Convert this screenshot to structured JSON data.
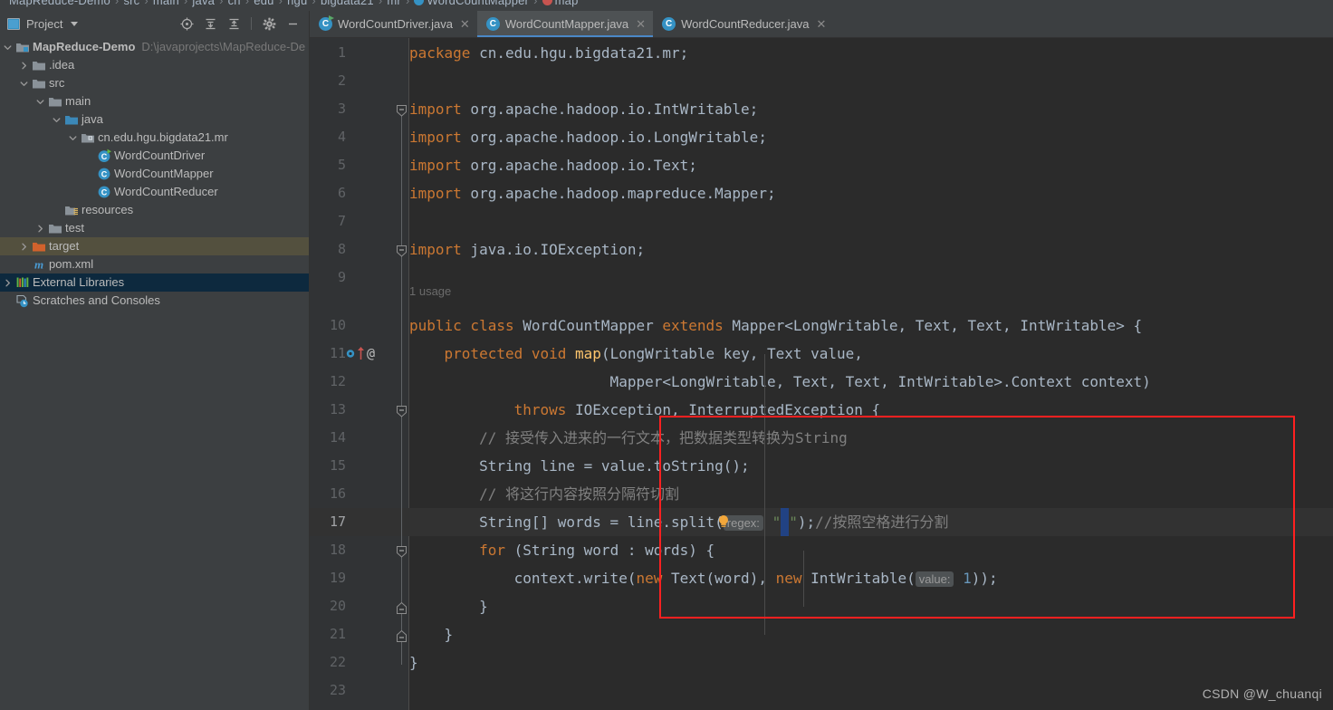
{
  "breadcrumb": {
    "items": [
      {
        "label": "MapReduce-Demo",
        "icon": "none"
      },
      {
        "label": "src",
        "icon": "none"
      },
      {
        "label": "main",
        "icon": "none"
      },
      {
        "label": "java",
        "icon": "none"
      },
      {
        "label": "cn",
        "icon": "none"
      },
      {
        "label": "edu",
        "icon": "none"
      },
      {
        "label": "hgu",
        "icon": "none"
      },
      {
        "label": "bigdata21",
        "icon": "none"
      },
      {
        "label": "mr",
        "icon": "none"
      },
      {
        "label": "WordCountMapper",
        "icon": "class-icon"
      },
      {
        "label": "map",
        "icon": "method-icon"
      }
    ],
    "separator": "›"
  },
  "project_panel": {
    "title": "Project",
    "dropdown_icon": "chevron-down-icon",
    "panel_icon": "project-view-icon",
    "toolbar": [
      {
        "name": "select-opened-file-icon",
        "tooltip": "Select Opened File"
      },
      {
        "name": "expand-all-icon",
        "tooltip": "Expand All"
      },
      {
        "name": "collapse-all-icon",
        "tooltip": "Collapse All"
      },
      {
        "name": "settings-gear-icon",
        "tooltip": "Settings"
      },
      {
        "name": "hide-icon",
        "tooltip": "Hide"
      }
    ],
    "tree": [
      {
        "label": "MapReduce-Demo",
        "suffix": "D:\\javaprojects\\MapReduce-De",
        "depth": 0,
        "arrow": "down",
        "icon": "project-module-icon",
        "bold": true,
        "selected": "none"
      },
      {
        "label": ".idea",
        "suffix": "",
        "depth": 1,
        "arrow": "right",
        "icon": "folder-icon",
        "bold": false,
        "selected": "none"
      },
      {
        "label": "src",
        "suffix": "",
        "depth": 1,
        "arrow": "down",
        "icon": "folder-icon",
        "bold": false,
        "selected": "none"
      },
      {
        "label": "main",
        "suffix": "",
        "depth": 2,
        "arrow": "down",
        "icon": "folder-icon",
        "bold": false,
        "selected": "none"
      },
      {
        "label": "java",
        "suffix": "",
        "depth": 3,
        "arrow": "down",
        "icon": "source-folder-icon",
        "bold": false,
        "selected": "none"
      },
      {
        "label": "cn.edu.hgu.bigdata21.mr",
        "suffix": "",
        "depth": 4,
        "arrow": "down",
        "icon": "package-icon",
        "bold": false,
        "selected": "none"
      },
      {
        "label": "WordCountDriver",
        "suffix": "",
        "depth": 5,
        "arrow": "none",
        "icon": "java-class-runnable-icon",
        "bold": false,
        "selected": "none"
      },
      {
        "label": "WordCountMapper",
        "suffix": "",
        "depth": 5,
        "arrow": "none",
        "icon": "java-class-icon",
        "bold": false,
        "selected": "none"
      },
      {
        "label": "WordCountReducer",
        "suffix": "",
        "depth": 5,
        "arrow": "none",
        "icon": "java-class-icon",
        "bold": false,
        "selected": "none"
      },
      {
        "label": "resources",
        "suffix": "",
        "depth": 3,
        "arrow": "none",
        "icon": "resources-folder-icon",
        "bold": false,
        "selected": "none"
      },
      {
        "label": "test",
        "suffix": "",
        "depth": 2,
        "arrow": "right",
        "icon": "folder-icon",
        "bold": false,
        "selected": "none"
      },
      {
        "label": "target",
        "suffix": "",
        "depth": 1,
        "arrow": "right",
        "icon": "excluded-folder-icon",
        "bold": false,
        "selected": "brown"
      },
      {
        "label": "pom.xml",
        "suffix": "",
        "depth": 1,
        "arrow": "none",
        "icon": "maven-icon",
        "bold": false,
        "selected": "none"
      },
      {
        "label": "External Libraries",
        "suffix": "",
        "depth": 0,
        "arrow": "right",
        "icon": "libraries-icon",
        "bold": false,
        "selected": "blue"
      },
      {
        "label": "Scratches and Consoles",
        "suffix": "",
        "depth": 0,
        "arrow": "none",
        "icon": "scratches-icon",
        "bold": false,
        "selected": "none"
      }
    ]
  },
  "editor": {
    "tabs": [
      {
        "label": "WordCountDriver.java",
        "icon": "java-class-runnable-icon",
        "active": false,
        "close_icon": "close-icon"
      },
      {
        "label": "WordCountMapper.java",
        "icon": "java-class-icon",
        "active": true,
        "close_icon": "close-icon"
      },
      {
        "label": "WordCountReducer.java",
        "icon": "java-class-icon",
        "active": false,
        "close_icon": "close-icon"
      }
    ],
    "usage_inlay": "1 usage",
    "current_line": 17,
    "line_numbers": [
      1,
      2,
      3,
      4,
      5,
      6,
      7,
      8,
      9,
      10,
      11,
      12,
      13,
      14,
      15,
      16,
      17,
      18,
      19,
      20,
      21,
      22,
      23
    ],
    "lines": [
      {
        "n": 1,
        "text": "package cn.edu.hgu.bigdata21.mr;"
      },
      {
        "n": 2,
        "text": ""
      },
      {
        "n": 3,
        "text": "import org.apache.hadoop.io.IntWritable;"
      },
      {
        "n": 4,
        "text": "import org.apache.hadoop.io.LongWritable;"
      },
      {
        "n": 5,
        "text": "import org.apache.hadoop.io.Text;"
      },
      {
        "n": 6,
        "text": "import org.apache.hadoop.mapreduce.Mapper;"
      },
      {
        "n": 7,
        "text": ""
      },
      {
        "n": 8,
        "text": "import java.io.IOException;"
      },
      {
        "n": 9,
        "text": ""
      },
      {
        "n": 10,
        "text": "public class WordCountMapper extends Mapper<LongWritable, Text, Text, IntWritable> {"
      },
      {
        "n": 11,
        "text": "    protected void map(LongWritable key, Text value,"
      },
      {
        "n": 12,
        "text": "                       Mapper<LongWritable, Text, Text, IntWritable>.Context context)"
      },
      {
        "n": 13,
        "text": "            throws IOException, InterruptedException {"
      },
      {
        "n": 14,
        "text": "        // 接受传入进来的一行文本，把数据类型转换为String"
      },
      {
        "n": 15,
        "text": "        String line = value.toString();"
      },
      {
        "n": 16,
        "text": "        // 将这行内容按照分隔符切割"
      },
      {
        "n": 17,
        "text": "        String[] words = line.split( regex: \" \");//按照空格进行分割"
      },
      {
        "n": 18,
        "text": "        for (String word : words) {"
      },
      {
        "n": 19,
        "text": "            context.write(new Text(word), new IntWritable( value: 1));"
      },
      {
        "n": 20,
        "text": "        }"
      },
      {
        "n": 21,
        "text": "    }"
      },
      {
        "n": 22,
        "text": "}"
      },
      {
        "n": 23,
        "text": ""
      }
    ],
    "parameter_hints": [
      {
        "line": 17,
        "label": "regex:"
      },
      {
        "line": 19,
        "label": "value:"
      }
    ],
    "gutter_icons": [
      {
        "line": 11,
        "name": "overridden-method-icon"
      },
      {
        "line": 11,
        "name": "annotation-at-icon",
        "glyph": "@"
      },
      {
        "line": 17,
        "name": "intention-bulb-icon"
      }
    ],
    "annotation_box": {
      "color": "#ff2020",
      "from_line": 14,
      "to_line": 20
    }
  },
  "watermark": "CSDN @W_chuanqi",
  "colors": {
    "editor_bg": "#2b2b2b",
    "panel_bg": "#3c3f41",
    "gutter_bg": "#313335",
    "accent_blue": "#3592c4",
    "keyword_orange": "#cc7832",
    "string_green": "#6a8759",
    "number_blue": "#6897bb",
    "comment_gray": "#808080",
    "method_yellow": "#ffc66d",
    "selection_brown": "#53503e",
    "selection_blue": "#0d293e",
    "annotation_red": "#ff2020"
  }
}
